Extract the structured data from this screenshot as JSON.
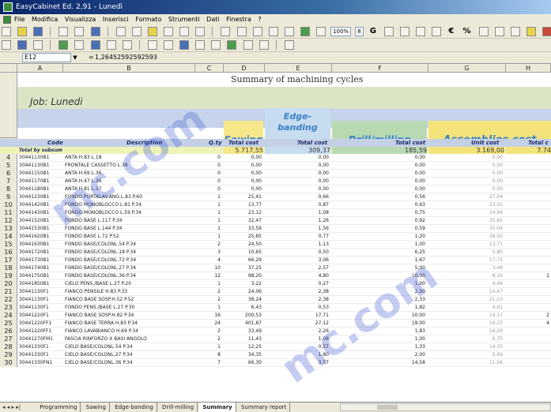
{
  "window": {
    "title": "EasyCabinet Ed. 2,91 - Lunedì"
  },
  "menu": [
    "File",
    "Modifica",
    "Visualizza",
    "Inserisci",
    "Formato",
    "Strumenti",
    "Dati",
    "Finestra",
    "?"
  ],
  "toolbar": {
    "zoom": "100%",
    "font_size": "8",
    "bold": "G",
    "currency": "€",
    "percent": "%"
  },
  "formula_bar": {
    "cell": "E12",
    "eq": "=",
    "value": "1,26452592592593"
  },
  "columns": [
    "A",
    "B",
    "C",
    "D",
    "E",
    "F",
    "G",
    "H"
  ],
  "sheet": {
    "title": "Summary of machining cycles",
    "job": "Job: Lunedi",
    "sections": {
      "sawing": "Sawing",
      "edge_a": "Edge-",
      "edge_b": "banding",
      "drill": "Drill/milling",
      "assemblies": "Assemblies cost"
    },
    "col_names": {
      "code": "Code",
      "description": "Description",
      "qty": "Q.ty",
      "saw_total": "Total cost",
      "edge_total": "Total cost",
      "drill_total": "Total cost",
      "unit_cost": "Unit cost",
      "total_last": "Total c"
    },
    "totals": {
      "label": "Total by subsum",
      "sawing": "5.717,55",
      "edge": "309,37",
      "drill": "185,59",
      "unit": "3.169,00",
      "last": "7.74"
    },
    "rows": [
      {
        "n": "4",
        "code": "30441130B1",
        "desc": "ANTA H.83 L.18",
        "qty": "0",
        "saw": "0,00",
        "edge": "0,00",
        "drill": "0,00",
        "unit": "0,00",
        "tot": ""
      },
      {
        "n": "5",
        "code": "30441130B1",
        "desc": "FRONTALE CASSETTO L.38",
        "qty": "0",
        "saw": "0,00",
        "edge": "0,00",
        "drill": "0,00",
        "unit": "0,00",
        "tot": ""
      },
      {
        "n": "6",
        "code": "30441150B1",
        "desc": "ANTA H.69 L.36",
        "qty": "0",
        "saw": "0,00",
        "edge": "0,00",
        "drill": "0,00",
        "unit": "0,00",
        "tot": ""
      },
      {
        "n": "7",
        "code": "30441170B1",
        "desc": "ANTA H.47 L.36",
        "qty": "0",
        "saw": "0,00",
        "edge": "0,00",
        "drill": "0,00",
        "unit": "0,00",
        "tot": ""
      },
      {
        "n": "8",
        "code": "30441180B1",
        "desc": "ANTA H.81 L.37",
        "qty": "0",
        "saw": "0,00",
        "edge": "0,00",
        "drill": "0,00",
        "unit": "0,00",
        "tot": ""
      },
      {
        "n": "9",
        "code": "30441230B1",
        "desc": "FONDO PORTALAV.ANG.L.83 P.60",
        "qty": "1",
        "saw": "25,41",
        "edge": "0,66",
        "drill": "0,56",
        "unit": "27,04",
        "tot": ""
      },
      {
        "n": "10",
        "code": "30441420B1",
        "desc": "FONDO MONOBLOCCO L.81 P.34",
        "qty": "1",
        "saw": "13,77",
        "edge": "0,87",
        "drill": "0,63",
        "unit": "23,25",
        "tot": ""
      },
      {
        "n": "11",
        "code": "30441430B1",
        "desc": "FONDO MONOBLOCCO L.59 P.34",
        "qty": "1",
        "saw": "23,12",
        "edge": "1,08",
        "drill": "0,75",
        "unit": "24,94",
        "tot": ""
      },
      {
        "n": "12",
        "code": "30441520B1",
        "desc": "FONDO BASE L.117 P.34",
        "qty": "1",
        "saw": "32,47",
        "edge": "1,26",
        "drill": "0,92",
        "unit": "35,65",
        "tot": ""
      },
      {
        "n": "13",
        "code": "30441530B1",
        "desc": "FONDO BASE L.144 P.34",
        "qty": "1",
        "saw": "33,59",
        "edge": "1,56",
        "drill": "0,59",
        "unit": "35,04",
        "tot": ""
      },
      {
        "n": "14",
        "code": "30441620B1",
        "desc": "FONDO BASE L.72 P.52",
        "qty": "1",
        "saw": "25,85",
        "edge": "0,77",
        "drill": "1,20",
        "unit": "28,00",
        "tot": ""
      },
      {
        "n": "15",
        "code": "30441630B1",
        "desc": "FONDO BASE/COLONL.54 P.34",
        "qty": "2",
        "saw": "24,50",
        "edge": "1,13",
        "drill": "1,00",
        "unit": "13,71",
        "tot": ""
      },
      {
        "n": "16",
        "code": "30441720B1",
        "desc": "FONDO BASE/COLONL.18 P.34",
        "qty": "3",
        "saw": "10,65",
        "edge": "0,50",
        "drill": "6,25",
        "unit": "5,80",
        "tot": ""
      },
      {
        "n": "17",
        "code": "30441730B1",
        "desc": "FONDO BASE/COLONL.72 P.34",
        "qty": "4",
        "saw": "66,29",
        "edge": "3,06",
        "drill": "1,67",
        "unit": "17,75",
        "tot": ""
      },
      {
        "n": "18",
        "code": "30441740B1",
        "desc": "FONDO BASE/COLONL.27 P.34",
        "qty": "10",
        "saw": "37,25",
        "edge": "2,57",
        "drill": "5,00",
        "unit": "3,48",
        "tot": ""
      },
      {
        "n": "19",
        "code": "30441750B1",
        "desc": "FONDO BASE/COLONL.36 P.34",
        "qty": "12",
        "saw": "98,20",
        "edge": "4,80",
        "drill": "10,00",
        "unit": "8,16",
        "tot": "1"
      },
      {
        "n": "20",
        "code": "30441850B1",
        "desc": "CIELO PENS./BASE L.27 P.20",
        "qty": "1",
        "saw": "3,22",
        "edge": "0,27",
        "drill": "1,00",
        "unit": "4,49",
        "tot": ""
      },
      {
        "n": "21",
        "code": "30441130F1",
        "desc": "FIANCO PENSILE H.83 P.33",
        "qty": "2",
        "saw": "24,06",
        "edge": "2,38",
        "drill": "2,50",
        "unit": "14,47",
        "tot": ""
      },
      {
        "n": "22",
        "code": "30441130F1",
        "desc": "FIANCO BASE SOSP.H.52 P.52",
        "qty": "2",
        "saw": "38,24",
        "edge": "2,38",
        "drill": "2,33",
        "unit": "21,23",
        "tot": ""
      },
      {
        "n": "23",
        "code": "30441130F1",
        "desc": "FONDO PENS./BASE L.27 P.30",
        "qty": "1",
        "saw": "6,43",
        "edge": "0,53",
        "drill": "1,82",
        "unit": "4,61",
        "tot": ""
      },
      {
        "n": "24",
        "code": "30441220F1",
        "desc": "FIANCO BASE SOSP.H.82 P.34",
        "qty": "16",
        "saw": "200,53",
        "edge": "17,71",
        "drill": "10,00",
        "unit": "14,17",
        "tot": "2"
      },
      {
        "n": "25",
        "code": "30441220FF1",
        "desc": "FIANCO BASE TERRA H.83 P.34",
        "qty": "24",
        "saw": "401,87",
        "edge": "27,12",
        "drill": "19,00",
        "unit": "19,23",
        "tot": "4"
      },
      {
        "n": "26",
        "code": "30441220FF1",
        "desc": "FIANCO LAVABIANCO H.69 P.34",
        "qty": "2",
        "saw": "33,49",
        "edge": "2,26",
        "drill": "1,83",
        "unit": "18,29",
        "tot": ""
      },
      {
        "n": "27",
        "code": "30441270FM1",
        "desc": "FASCIA RINFORZO X BASI ANGOLO",
        "qty": "2",
        "saw": "11,43",
        "edge": "1,06",
        "drill": "1,00",
        "unit": "6,75",
        "tot": ""
      },
      {
        "n": "28",
        "code": "30441330F1",
        "desc": "CIELO BASE/COLONL.54 P.34",
        "qty": "1",
        "saw": "12,25",
        "edge": "0,57",
        "drill": "1,33",
        "unit": "14,15",
        "tot": ""
      },
      {
        "n": "29",
        "code": "30441330F1",
        "desc": "CIELO BASE/COLONL.27 P.34",
        "qty": "8",
        "saw": "34,35",
        "edge": "1,80",
        "drill": "2,00",
        "unit": "5,69",
        "tot": ""
      },
      {
        "n": "30",
        "code": "30441330FN1",
        "desc": "CIELO BASE/COLONL.36 P.34",
        "qty": "7",
        "saw": "66,30",
        "edge": "3,57",
        "drill": "14,58",
        "unit": "11,56",
        "tot": ""
      }
    ]
  },
  "tabs": [
    "Programming",
    "Sawing",
    "Edge-banding",
    "Drill-milling",
    "Summary",
    "Summary report"
  ],
  "tab_nav": "◂ ◂ ▸ ▸|",
  "watermark": "mc.com"
}
